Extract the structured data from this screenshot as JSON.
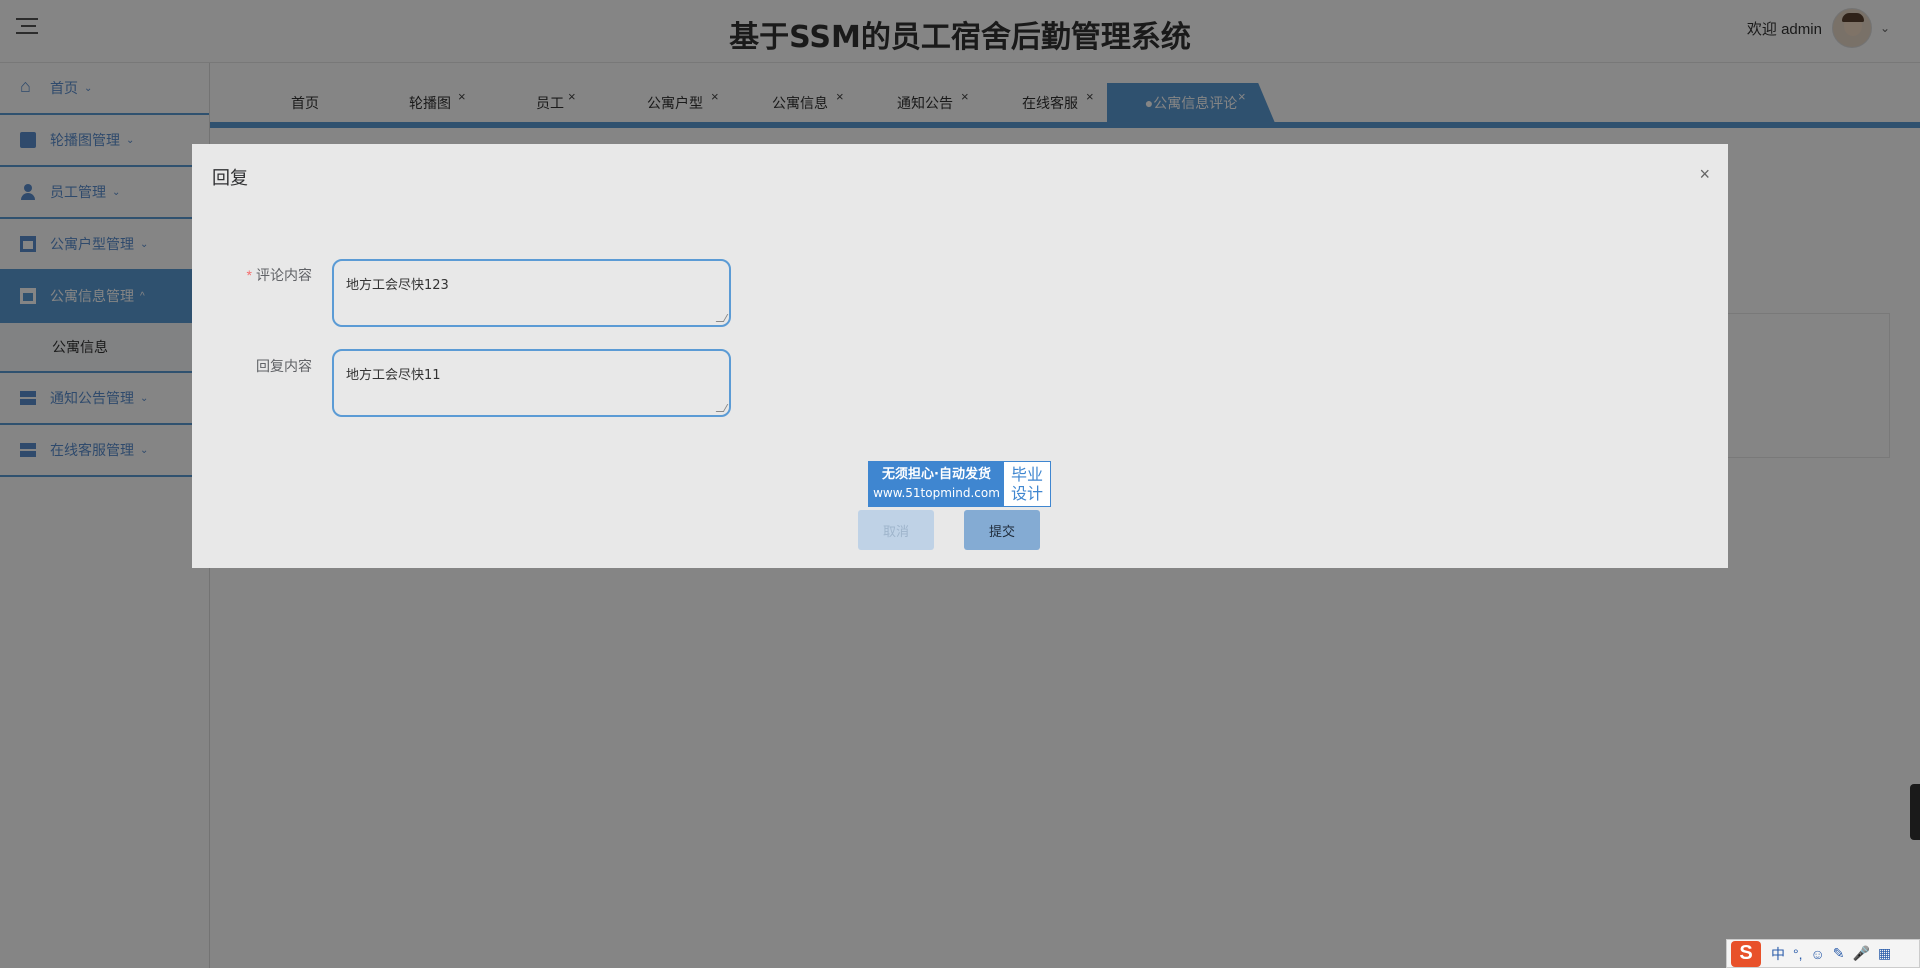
{
  "header": {
    "title": "基于SSM的员工宿舍后勤管理系统",
    "welcome": "欢迎 admin",
    "user_chevron": "⌄"
  },
  "sidebar": {
    "items": [
      {
        "label": "首页",
        "arrow": "⌄"
      },
      {
        "label": "轮播图管理",
        "arrow": "⌄"
      },
      {
        "label": "员工管理",
        "arrow": "⌄"
      },
      {
        "label": "公寓户型管理",
        "arrow": "⌄"
      },
      {
        "label": "公寓信息管理",
        "arrow": "^"
      },
      {
        "label": "通知公告管理",
        "arrow": "⌄"
      },
      {
        "label": "在线客服管理",
        "arrow": "⌄"
      }
    ],
    "sub_item": "公寓信息"
  },
  "tabs": [
    {
      "label": "首页",
      "closable": false
    },
    {
      "label": "轮播图",
      "closable": true
    },
    {
      "label": "员工",
      "closable": true
    },
    {
      "label": "公寓户型",
      "closable": true
    },
    {
      "label": "公寓信息",
      "closable": true
    },
    {
      "label": "通知公告",
      "closable": true
    },
    {
      "label": "在线客服",
      "closable": true
    },
    {
      "label": "●公寓信息评论",
      "closable": true,
      "active": true
    }
  ],
  "tab_close_glyph": "×",
  "dialog": {
    "title": "回复",
    "close_glyph": "×",
    "comment_label": "评论内容",
    "required_mark": "*",
    "comment_value": "地方工会尽快123",
    "reply_label": "回复内容",
    "reply_value": "地方工会尽快11",
    "cancel_label": "取消",
    "submit_label": "提交"
  },
  "ad": {
    "line1": "无须担心·自动发货",
    "line2": "www.51topmind.com",
    "right1": "毕业",
    "right2": "设计"
  },
  "ime": {
    "logo": "S",
    "items": [
      "中",
      "°,",
      "☺",
      "✎",
      "🎤",
      "▦"
    ]
  },
  "colors": {
    "accent": "#5b9bd5",
    "overlay": "rgba(0,0,0,0.48)",
    "dialog_bg": "#e8e8e8",
    "required": "#f56c6c"
  }
}
